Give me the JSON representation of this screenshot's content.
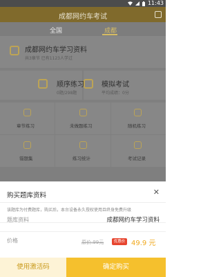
{
  "status_bar": {
    "time": "11:43"
  },
  "header": {
    "title": "成都网约车考试"
  },
  "tabs": [
    {
      "label": "全国"
    },
    {
      "label": "成都"
    }
  ],
  "study_card": {
    "title": "成都网约车学习资料",
    "subtitle": "共3章节 已有1123人学过"
  },
  "modes": [
    {
      "title": "顺序练习",
      "subtitle": "0题/298题"
    },
    {
      "title": "模拟考试",
      "subtitle": "平均成绩：0分"
    }
  ],
  "grid_items": [
    {
      "label": "章节练习"
    },
    {
      "label": "未做题练习"
    },
    {
      "label": "随机练习"
    },
    {
      "label": "错题集"
    },
    {
      "label": "练习统计"
    },
    {
      "label": "考试记录"
    }
  ],
  "sheet": {
    "title": "购买题库资料",
    "description": "该题库为付费题库，购买后，本台设备永久授权使用且终身免费升级",
    "bank_label": "题库资料",
    "bank_value": "成都网约车学习资料",
    "price_label": "价格",
    "original_price": "原价:99元",
    "discount_badge": "优惠价",
    "price": "49.9 元"
  },
  "buttons": {
    "activation": "使用激活码",
    "buy": "确定购买"
  },
  "colors": {
    "accent": "#f5c02d",
    "price": "#f0a81c",
    "badge": "#e7452f",
    "header": "#806a2c"
  }
}
